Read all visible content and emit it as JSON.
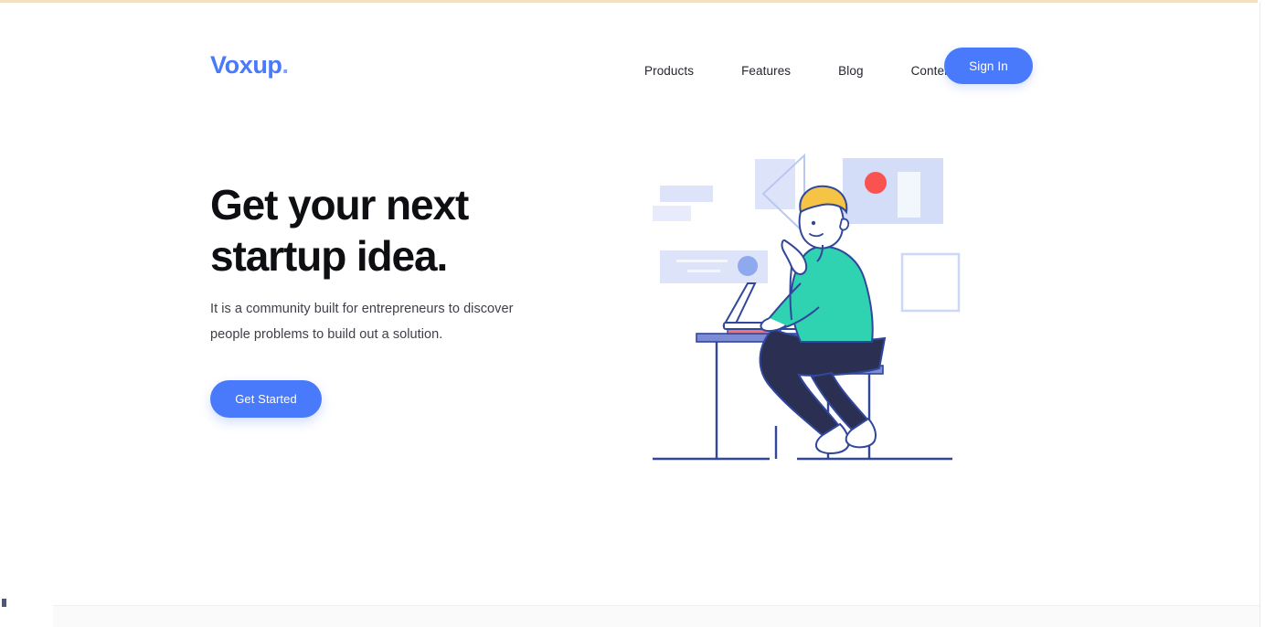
{
  "brand": {
    "name": "Voxup",
    "dot": ".",
    "color": "#4a7afc"
  },
  "header": {
    "nav": [
      {
        "label": "Products"
      },
      {
        "label": "Features"
      },
      {
        "label": "Blog"
      },
      {
        "label": "Content"
      }
    ],
    "sign_in_label": "Sign In"
  },
  "hero": {
    "title_line_1": "Get your next",
    "title_line_2": "startup idea.",
    "subtitle": "It is a community built for entrepreneurs to discover people problems to build out a solution.",
    "cta_label": "Get Started"
  },
  "illustration": {
    "name": "person-working-at-desk-illustration",
    "shapes": [
      {
        "name": "small-rectangle-top",
        "color": "#dde4f9"
      },
      {
        "name": "small-rectangle-left",
        "color": "#e6ebfa"
      },
      {
        "name": "square-behind-play-triangle",
        "color": "#dde4f9"
      },
      {
        "name": "play-triangle-outline",
        "color": "#b9c7f2"
      },
      {
        "name": "panel-with-red-dot",
        "color": "#d3ddf8"
      },
      {
        "name": "red-dot",
        "color": "#f9534f"
      },
      {
        "name": "white-card-in-panel",
        "color": "#f2f6fd"
      },
      {
        "name": "search-bar-card",
        "color": "#dde4f9"
      },
      {
        "name": "search-bar-avatar-circle",
        "color": "#8fa9ee"
      },
      {
        "name": "empty-square-outline",
        "color": "#ccd8f7"
      }
    ],
    "figure": {
      "hair_color": "#f6c445",
      "shirt_color": "#2fd3b1",
      "trousers_color": "#2b3052",
      "shoe_color": "#ffffff",
      "outline_color": "#31479b",
      "desk_color": "#7c8cd6",
      "book_color": "#f4726d"
    }
  },
  "colors": {
    "accent": "#4a7afc",
    "text_dark": "#0e0f12",
    "text_body": "#3d4049",
    "top_rule": "#f3dfc2"
  }
}
